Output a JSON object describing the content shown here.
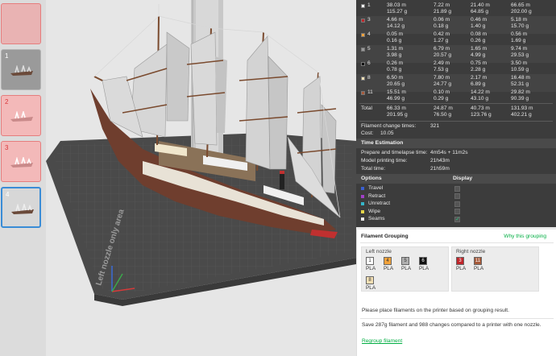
{
  "plates": [
    {
      "num": "",
      "state": "red-empty"
    },
    {
      "num": "1",
      "state": "normal"
    },
    {
      "num": "2",
      "state": "red"
    },
    {
      "num": "3",
      "state": "red"
    },
    {
      "num": "4",
      "state": "selected"
    }
  ],
  "viewport": {
    "bed_label": "Left nozzle only area"
  },
  "extruders": [
    {
      "id": "1",
      "color": "#f2f2f2",
      "c1": [
        "38.03 m",
        "115.27 g"
      ],
      "c2": [
        "7.22 m",
        "21.89 g"
      ],
      "c3": [
        "21.40 m",
        "64.85 g"
      ],
      "c4": [
        "66.65 m",
        "202.00 g"
      ]
    },
    {
      "id": "3",
      "color": "#c0262b",
      "c1": [
        "4.66 m",
        "14.12 g"
      ],
      "c2": [
        "0.06 m",
        "0.18 g"
      ],
      "c3": [
        "0.46 m",
        "1.40 g"
      ],
      "c4": [
        "5.18 m",
        "15.70 g"
      ]
    },
    {
      "id": "4",
      "color": "#f2a23a",
      "c1": [
        "0.05 m",
        "0.16 g"
      ],
      "c2": [
        "0.42 m",
        "1.27 g"
      ],
      "c3": [
        "0.08 m",
        "0.26 g"
      ],
      "c4": [
        "0.56 m",
        "1.69 g"
      ]
    },
    {
      "id": "5",
      "color": "#9a9a9a",
      "c1": [
        "1.31 m",
        "3.98 g"
      ],
      "c2": [
        "6.79 m",
        "20.57 g"
      ],
      "c3": [
        "1.65 m",
        "4.99 g"
      ],
      "c4": [
        "9.74 m",
        "29.53 g"
      ]
    },
    {
      "id": "6",
      "color": "#111111",
      "c1": [
        "0.26 m",
        "0.78 g"
      ],
      "c2": [
        "2.49 m",
        "7.53 g"
      ],
      "c3": [
        "0.75 m",
        "2.28 g"
      ],
      "c4": [
        "3.50 m",
        "10.59 g"
      ]
    },
    {
      "id": "8",
      "color": "#f3e0b5",
      "c1": [
        "6.50 m",
        "20.65 g"
      ],
      "c2": [
        "7.80 m",
        "24.77 g"
      ],
      "c3": [
        "2.17 m",
        "6.89 g"
      ],
      "c4": [
        "16.48 m",
        "52.31 g"
      ]
    },
    {
      "id": "11",
      "color": "#a65a3a",
      "c1": [
        "15.51 m",
        "46.99 g"
      ],
      "c2": [
        "0.10 m",
        "0.29 g"
      ],
      "c3": [
        "14.22 m",
        "43.10 g"
      ],
      "c4": [
        "29.82 m",
        "90.39 g"
      ]
    }
  ],
  "total": {
    "label": "Total",
    "c1": [
      "66.33 m",
      "201.95 g"
    ],
    "c2": [
      "24.87 m",
      "76.50 g"
    ],
    "c3": [
      "40.73 m",
      "123.76 g"
    ],
    "c4": [
      "131.93 m",
      "402.21 g"
    ]
  },
  "filament_change": {
    "label": "Filament change times:",
    "value": "321"
  },
  "cost": {
    "label": "Cost:",
    "value": "10.05"
  },
  "time_estimation": {
    "title": "Time Estimation",
    "rows": [
      {
        "label": "Prepare and timelapse time:",
        "value": "4m54s + 11m2s"
      },
      {
        "label": "Model printing time:",
        "value": "21h43m"
      },
      {
        "label": "Total time:",
        "value": "21h59m"
      }
    ]
  },
  "options": {
    "title": "Options",
    "display_title": "Display",
    "items": [
      {
        "label": "Travel",
        "color": "#3a5fd0",
        "checked": false
      },
      {
        "label": "Retract",
        "color": "#a13fc7",
        "checked": false
      },
      {
        "label": "Unretract",
        "color": "#35b6c9",
        "checked": false
      },
      {
        "label": "Wipe",
        "color": "#e6d64a",
        "checked": false
      },
      {
        "label": "Seams",
        "color": "#e8e8e8",
        "checked": true
      }
    ]
  },
  "grouping": {
    "title": "Filament Grouping",
    "why_link": "Why this grouping",
    "left_nozzle": {
      "title": "Left nozzle",
      "filaments": [
        {
          "id": "1",
          "type": "PLA",
          "color": "#ffffff",
          "text_color": "#333333"
        },
        {
          "id": "4",
          "type": "PLA",
          "color": "#f2a23a",
          "text_color": "#333333"
        },
        {
          "id": "5",
          "type": "PLA",
          "color": "#b0b0b0",
          "text_color": "#333333"
        },
        {
          "id": "6",
          "type": "PLA",
          "color": "#111111",
          "text_color": "#ffffff"
        },
        {
          "id": "8",
          "type": "PLA",
          "color": "#f3e0b5",
          "text_color": "#333333"
        }
      ]
    },
    "right_nozzle": {
      "title": "Right nozzle",
      "filaments": [
        {
          "id": "3",
          "type": "PLA",
          "color": "#c0262b",
          "text_color": "#ffffff"
        },
        {
          "id": "11",
          "type": "PLA",
          "color": "#a65a3a",
          "text_color": "#ffffff"
        }
      ]
    },
    "message1": "Please place filaments on the printer based on grouping result.",
    "message2": "Save 287g filament and 988 changes compared to a printer with one nozzle.",
    "regroup_link": "Regroup filament"
  }
}
